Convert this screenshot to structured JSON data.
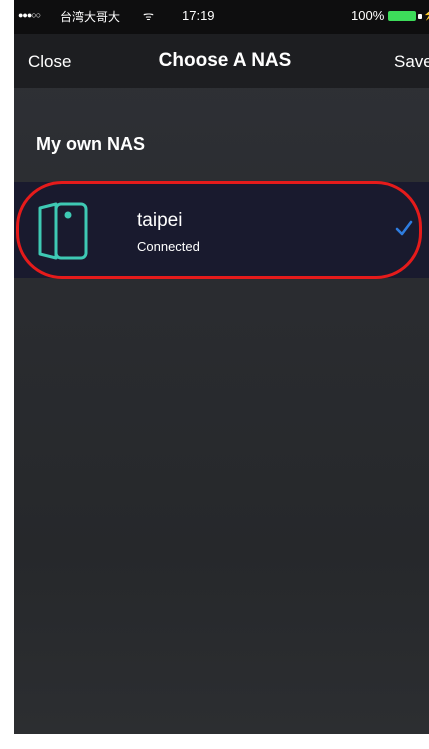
{
  "status_bar": {
    "signal": "●●●○○",
    "carrier": "台湾大哥大",
    "wifi": "ᯤ",
    "time": "17:19",
    "battery": "100%"
  },
  "nav": {
    "close_label": "Close",
    "title": "Choose A NAS",
    "save_label": "Save"
  },
  "section": {
    "title": "My own NAS"
  },
  "nas_list": [
    {
      "name": "taipei",
      "status": "Connected",
      "icon": "nas-device-icon",
      "selected": true
    }
  ],
  "colors": {
    "accent": "#2e7de0",
    "device_icon": "#3ec9b4",
    "highlight": "#e51b1b",
    "battery": "#3ddc5a"
  }
}
